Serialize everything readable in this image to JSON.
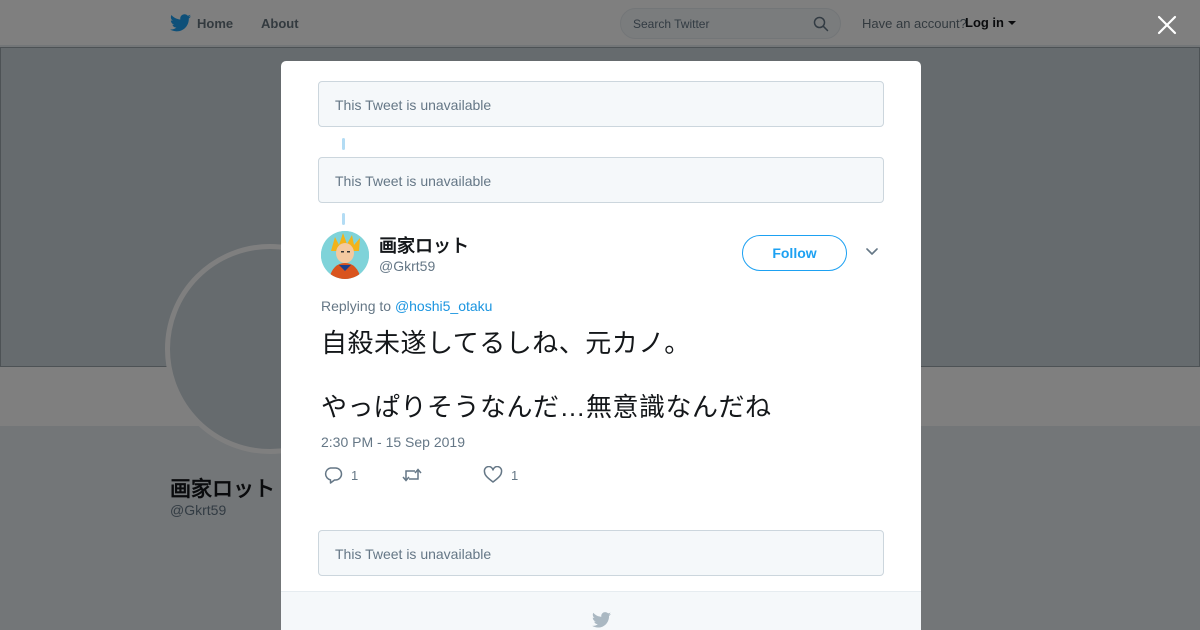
{
  "nav": {
    "home_label": "Home",
    "about_label": "About",
    "search_placeholder": "Search Twitter",
    "have_account": "Have an account?",
    "login_label": "Log in"
  },
  "profile": {
    "name": "画家ロット",
    "handle": "@Gkrt59"
  },
  "thread": {
    "unavailable_text": "This Tweet is unavailable",
    "unavailable_text_2": "This Tweet is unavailable",
    "unavailable_text_3": "This Tweet is unavailable"
  },
  "tweet": {
    "author_name": "画家ロット",
    "author_handle": "@Gkrt59",
    "follow_label": "Follow",
    "replying_prefix": "Replying to",
    "replying_to": "@hoshi5_otaku",
    "text_line1": "自殺未遂してるしね、元カノ。",
    "text_line2": "やっぱりそうなんだ…無意識なんだね",
    "timestamp": "2:30 PM - 15 Sep 2019",
    "reply_count": "1",
    "like_count": "1"
  },
  "colors": {
    "brand_blue": "#1da1f2",
    "link_blue": "#1b95e0",
    "muted": "#657786"
  },
  "icons": [
    "twitter-bird-icon",
    "search-icon",
    "caret-down-icon",
    "close-icon",
    "chevron-down-icon",
    "reply-icon",
    "retweet-icon",
    "like-icon"
  ]
}
